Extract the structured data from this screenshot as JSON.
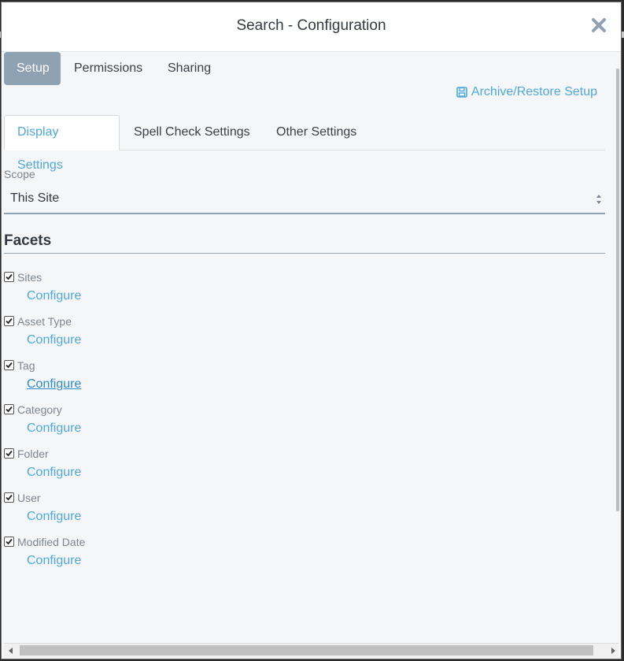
{
  "dialog": {
    "title": "Search - Configuration"
  },
  "top_tabs": [
    {
      "label": "Setup",
      "active": true
    },
    {
      "label": "Permissions",
      "active": false
    },
    {
      "label": "Sharing",
      "active": false
    }
  ],
  "archive_link": {
    "label": "Archive/Restore Setup",
    "icon": "save-icon"
  },
  "sub_tabs": [
    {
      "label": "Display Settings",
      "active": true
    },
    {
      "label": "Spell Check Settings",
      "active": false
    },
    {
      "label": "Other Settings",
      "active": false
    }
  ],
  "scope": {
    "label": "Scope",
    "value": "This Site"
  },
  "facets": {
    "heading": "Facets",
    "items": [
      {
        "label": "Sites",
        "checked": true,
        "configure": "Configure"
      },
      {
        "label": "Asset Type",
        "checked": true,
        "configure": "Configure"
      },
      {
        "label": "Tag",
        "checked": true,
        "configure": "Configure"
      },
      {
        "label": "Category",
        "checked": true,
        "configure": "Configure"
      },
      {
        "label": "Folder",
        "checked": true,
        "configure": "Configure"
      },
      {
        "label": "User",
        "checked": true,
        "configure": "Configure"
      },
      {
        "label": "Modified Date",
        "checked": true,
        "configure": "Configure"
      }
    ]
  },
  "colors": {
    "accent": "#4ea8df",
    "active_tab": "#8fa2b3",
    "text": "#333a42"
  }
}
